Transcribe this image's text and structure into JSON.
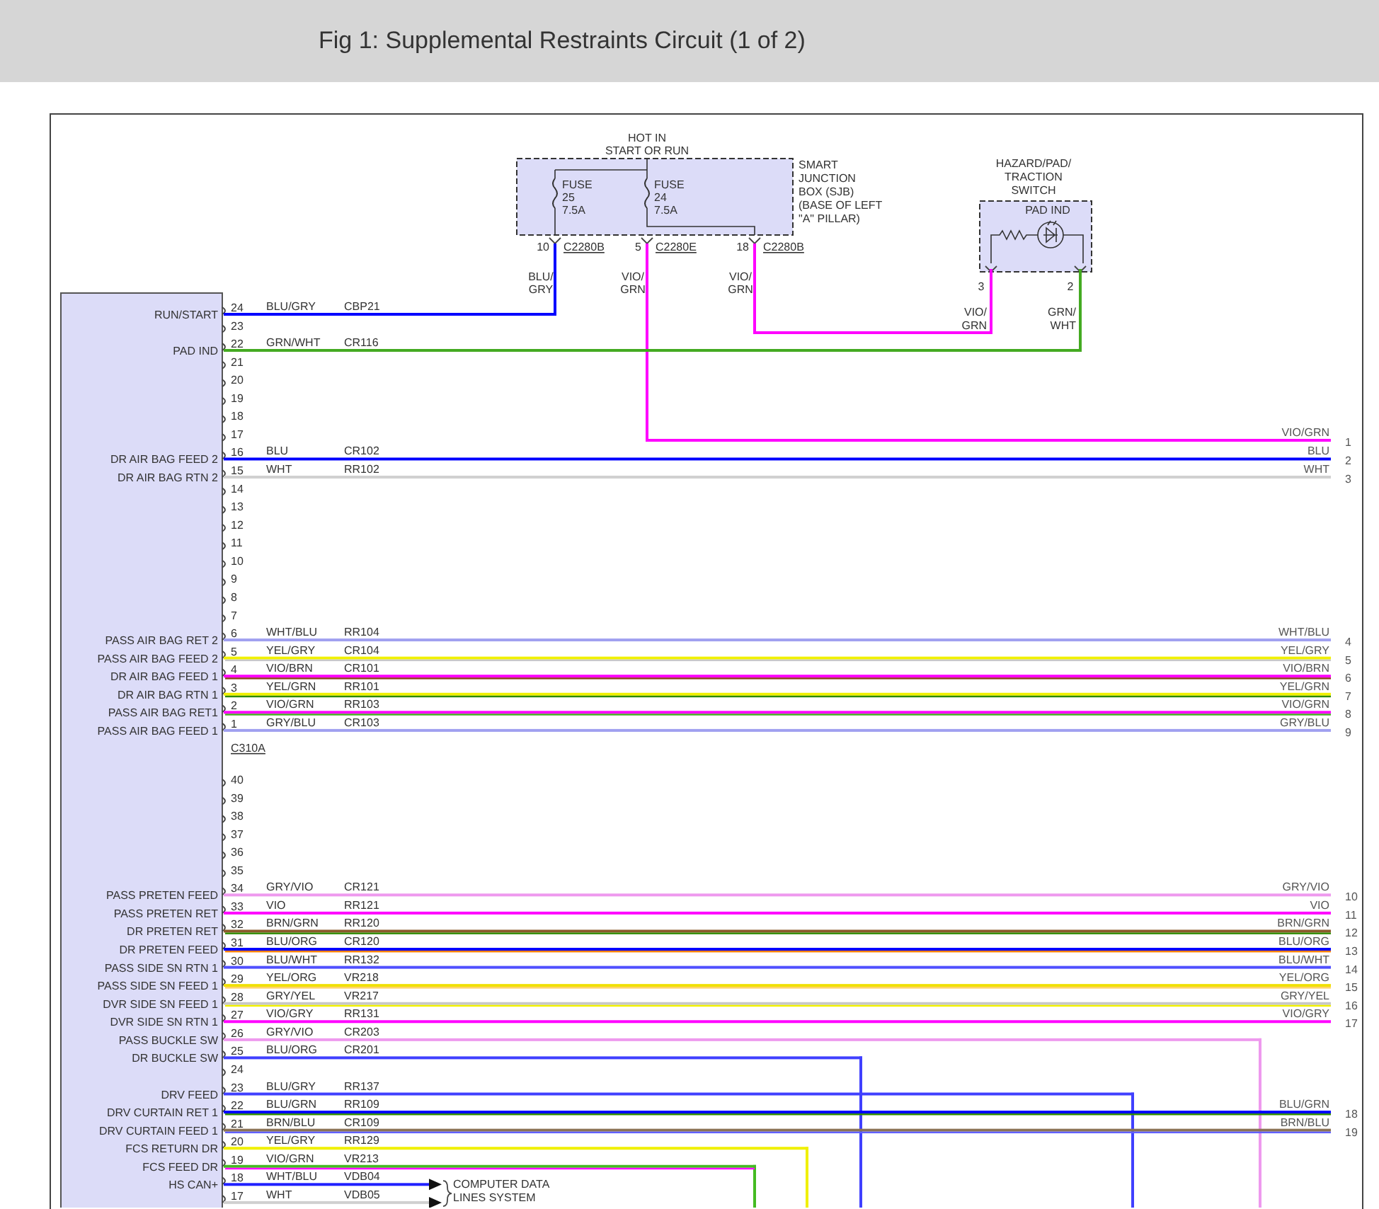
{
  "header": {
    "title": "Fig 1: Supplemental Restraints Circuit (1 of 2)"
  },
  "sjb": {
    "hot_in": [
      "HOT IN",
      "START OR RUN"
    ],
    "label_lines": [
      "SMART",
      "JUNCTION",
      "BOX (SJB)",
      "(BASE OF LEFT",
      "\"A\" PILLAR)"
    ],
    "fuses": [
      {
        "label": "FUSE",
        "number": "25",
        "rating": "7.5A"
      },
      {
        "label": "FUSE",
        "number": "24",
        "rating": "7.5A"
      }
    ],
    "pins": [
      {
        "pin": "10",
        "connector": "C2280B",
        "wire": "BLU/GRY"
      },
      {
        "pin": "5",
        "connector": "C2280E",
        "wire": "VIO/GRN",
        "color": "#ff00ff",
        "right": {
          "label": "VIO/GRN",
          "pin": "1"
        }
      },
      {
        "pin": "18",
        "connector": "C2280B",
        "wire": "VIO/GRN",
        "color": "#ff00ff"
      }
    ]
  },
  "switch": {
    "title_lines": [
      "HAZARD/PAD/",
      "TRACTION",
      "SWITCH"
    ],
    "inner_label": "PAD IND",
    "pins": [
      {
        "pin": "3",
        "wire": "VIO/GRN"
      },
      {
        "pin": "2",
        "wire": "GRN/WHT"
      }
    ]
  },
  "module": {
    "connectors": [
      {
        "name": "C310A",
        "pins": [
          {
            "pin": "24",
            "kind": "sjb",
            "label": "RUN/START",
            "wire": "BLU/GRY",
            "circuit": "CBP21",
            "color": "#0000ff"
          },
          {
            "pin": "23",
            "kind": "stub"
          },
          {
            "pin": "22",
            "kind": "switch",
            "label": "PAD IND",
            "wire": "GRN/WHT",
            "circuit": "CR116",
            "color": "#44aa22"
          },
          {
            "pin": "21",
            "kind": "stub"
          },
          {
            "pin": "20",
            "kind": "stub"
          },
          {
            "pin": "19",
            "kind": "stub"
          },
          {
            "pin": "18",
            "kind": "stub"
          },
          {
            "pin": "17",
            "kind": "stub"
          },
          {
            "pin": "16",
            "kind": "through",
            "label": "DR AIR BAG FEED 2",
            "wire": "BLU",
            "circuit": "CR102",
            "color": "#0000ff",
            "right": {
              "label": "BLU",
              "pin": "2"
            }
          },
          {
            "pin": "15",
            "kind": "through",
            "label": "DR AIR BAG RTN 2",
            "wire": "WHT",
            "circuit": "RR102",
            "color": "#d0d0d0",
            "right": {
              "label": "WHT",
              "pin": "3"
            }
          },
          {
            "pin": "14",
            "kind": "stub"
          },
          {
            "pin": "13",
            "kind": "stub"
          },
          {
            "pin": "12",
            "kind": "stub"
          },
          {
            "pin": "11",
            "kind": "stub"
          },
          {
            "pin": "10",
            "kind": "stub"
          },
          {
            "pin": "9",
            "kind": "stub"
          },
          {
            "pin": "8",
            "kind": "stub"
          },
          {
            "pin": "7",
            "kind": "stub"
          },
          {
            "pin": "6",
            "kind": "through",
            "label": "PASS AIR BAG RET 2",
            "wire": "WHT/BLU",
            "circuit": "RR104",
            "color": "#a0a0f0",
            "right": {
              "label": "WHT/BLU",
              "pin": "4"
            }
          },
          {
            "pin": "5",
            "kind": "through",
            "label": "PASS AIR BAG FEED 2",
            "wire": "YEL/GRY",
            "circuit": "CR104",
            "color": "#f0f000",
            "stripe": {
              "color": "#c8c8c8"
            },
            "right": {
              "label": "YEL/GRY",
              "pin": "5"
            }
          },
          {
            "pin": "4",
            "kind": "through",
            "label": "DR AIR BAG FEED 1",
            "wire": "VIO/BRN",
            "circuit": "CR101",
            "color": "#ff00ff",
            "stripe": {
              "color": "#8b3a1a"
            },
            "right": {
              "label": "VIO/BRN",
              "pin": "6"
            }
          },
          {
            "pin": "3",
            "kind": "through",
            "label": "DR AIR BAG RTN 1",
            "wire": "YEL/GRN",
            "circuit": "RR101",
            "color": "#f0f000",
            "stripe": {
              "color": "#2e8b00"
            },
            "right": {
              "label": "YEL/GRN",
              "pin": "7"
            }
          },
          {
            "pin": "2",
            "kind": "through",
            "label": "PASS AIR BAG RET1",
            "wire": "VIO/GRN",
            "circuit": "RR103",
            "color": "#ff00ff",
            "stripe": {
              "color": "#44aa22"
            },
            "right": {
              "label": "VIO/GRN",
              "pin": "8"
            }
          },
          {
            "pin": "1",
            "kind": "through",
            "label": "PASS AIR BAG FEED 1",
            "wire": "GRY/BLU",
            "circuit": "CR103",
            "color": "#a0a0f0",
            "right": {
              "label": "GRY/BLU",
              "pin": "9"
            }
          }
        ]
      },
      {
        "pins": [
          {
            "pin": "40",
            "kind": "stub"
          },
          {
            "pin": "39",
            "kind": "stub"
          },
          {
            "pin": "38",
            "kind": "stub"
          },
          {
            "pin": "37",
            "kind": "stub"
          },
          {
            "pin": "36",
            "kind": "stub"
          },
          {
            "pin": "35",
            "kind": "stub"
          },
          {
            "pin": "34",
            "kind": "through",
            "label": "PASS PRETEN FEED",
            "wire": "GRY/VIO",
            "circuit": "CR121",
            "color": "#ee99ee",
            "right": {
              "label": "GRY/VIO",
              "pin": "10"
            }
          },
          {
            "pin": "33",
            "kind": "through",
            "label": "PASS PRETEN RET",
            "wire": "VIO",
            "circuit": "RR121",
            "color": "#ff00ff",
            "right": {
              "label": "VIO",
              "pin": "11"
            }
          },
          {
            "pin": "32",
            "kind": "through",
            "label": "DR PRETEN RET",
            "wire": "BRN/GRN",
            "circuit": "RR120",
            "color": "#8b5a2b",
            "stripe": {
              "color": "#2e8b00"
            },
            "right": {
              "label": "BRN/GRN",
              "pin": "12"
            }
          },
          {
            "pin": "31",
            "kind": "through",
            "label": "DR PRETEN FEED",
            "wire": "BLU/ORG",
            "circuit": "CR120",
            "color": "#0000ff",
            "stripe": {
              "color": "#ff8000"
            },
            "right": {
              "label": "BLU/ORG",
              "pin": "13"
            }
          },
          {
            "pin": "30",
            "kind": "through",
            "label": "PASS SIDE SN RTN 1",
            "wire": "BLU/WHT",
            "circuit": "RR132",
            "color": "#5050ff",
            "right": {
              "label": "BLU/WHT",
              "pin": "14"
            }
          },
          {
            "pin": "29",
            "kind": "through",
            "label": "PASS SIDE SN FEED 1",
            "wire": "YEL/ORG",
            "circuit": "VR218",
            "color": "#f0e000",
            "stripe": {
              "color": "#ffd060"
            },
            "right": {
              "label": "YEL/ORG",
              "pin": "15"
            }
          },
          {
            "pin": "28",
            "kind": "through",
            "label": "DVR SIDE SN FEED 1",
            "wire": "GRY/YEL",
            "circuit": "VR217",
            "color": "#c8c8c8",
            "stripe": {
              "color": "#f0f000"
            },
            "right": {
              "label": "GRY/YEL",
              "pin": "16"
            }
          },
          {
            "pin": "27",
            "kind": "through",
            "label": "DVR SIDE SN RTN 1",
            "wire": "VIO/GRY",
            "circuit": "RR131",
            "color": "#ff00ff",
            "right": {
              "label": "VIO/GRY",
              "pin": "17"
            }
          },
          {
            "pin": "26",
            "kind": "down",
            "label": "PASS BUCKLE SW",
            "wire": "GRY/VIO",
            "circuit": "CR203",
            "color": "#ee99ee"
          },
          {
            "pin": "25",
            "kind": "down",
            "label": "DR BUCKLE SW",
            "wire": "BLU/ORG",
            "circuit": "CR201",
            "color": "#4040ff"
          },
          {
            "pin": "24",
            "kind": "stub"
          },
          {
            "pin": "23",
            "kind": "down",
            "label": "DRV FEED",
            "wire": "BLU/GRY",
            "circuit": "RR137",
            "color": "#4040ff"
          },
          {
            "pin": "22",
            "kind": "through",
            "label": "DRV CURTAIN RET 1",
            "wire": "BLU/GRN",
            "circuit": "RR109",
            "color": "#0000ff",
            "stripe": {
              "color": "#2e8b00"
            },
            "right": {
              "label": "BLU/GRN",
              "pin": "18"
            }
          },
          {
            "pin": "21",
            "kind": "through",
            "label": "DRV CURTAIN FEED 1",
            "wire": "BRN/BLU",
            "circuit": "CR109",
            "color": "#8b7355",
            "stripe": {
              "color": "#6060ff"
            },
            "right": {
              "label": "BRN/BLU",
              "pin": "19"
            }
          },
          {
            "pin": "20",
            "kind": "down",
            "label": "FCS RETURN DR",
            "wire": "YEL/GRY",
            "circuit": "RR129",
            "color": "#f0f000"
          },
          {
            "pin": "19",
            "kind": "down",
            "label": "FCS FEED DR",
            "wire": "VIO/GRN",
            "circuit": "VR213",
            "color": "#44bb22",
            "stripe": {
              "color": "#ff00ff"
            }
          },
          {
            "pin": "18",
            "kind": "data",
            "label": "HS CAN+",
            "wire": "WHT/BLU",
            "circuit": "VDB04",
            "color": "#2020ff"
          },
          {
            "pin": "17",
            "kind": "data",
            "wire": "WHT",
            "circuit": "VDB05",
            "color": "#d0d0d0"
          }
        ]
      }
    ]
  },
  "data_link": {
    "lines": [
      "COMPUTER DATA",
      "LINES SYSTEM"
    ]
  }
}
